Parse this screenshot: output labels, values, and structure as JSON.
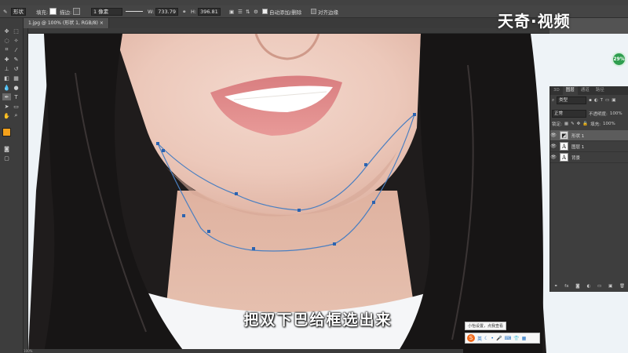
{
  "options_bar": {
    "shape_mode": "形状",
    "fill_label": "填充:",
    "stroke_label": "描边:",
    "stroke_width": "1 像素",
    "width_label": "W:",
    "width_value": "733.79",
    "height_label": "H:",
    "height_value": "396.81",
    "auto_add_delete": "自动添加/删除",
    "align_edges": "对齐边缘"
  },
  "document_tab": {
    "title": "1.jpg @ 100% (形状 1, RGB/8)"
  },
  "watermark": "天奇·视频",
  "subtitle": "把双下巴给框选出来",
  "badge": "29%",
  "layers_panel": {
    "tabs": [
      "3D",
      "图层",
      "通道",
      "路径"
    ],
    "active_tab": "图层",
    "filter_kind": "类型",
    "blend_mode": "正常",
    "opacity_label": "不透明度:",
    "opacity_value": "100%",
    "lock_label": "锁定:",
    "fill_label": "填充:",
    "fill_value": "100%",
    "layers": [
      {
        "name": "形状 1",
        "selected": true
      },
      {
        "name": "图层 1",
        "selected": false
      },
      {
        "name": "背景",
        "selected": false
      }
    ]
  },
  "ime": {
    "tooltip": "小怡设置，点我查看",
    "mode": "英"
  },
  "status_bar": {
    "zoom": "100%"
  },
  "colors": {
    "foreground": "#f4a11b",
    "background": "#ffffff",
    "path_stroke": "#4a7fc1",
    "anchor": "#2b63b0"
  }
}
